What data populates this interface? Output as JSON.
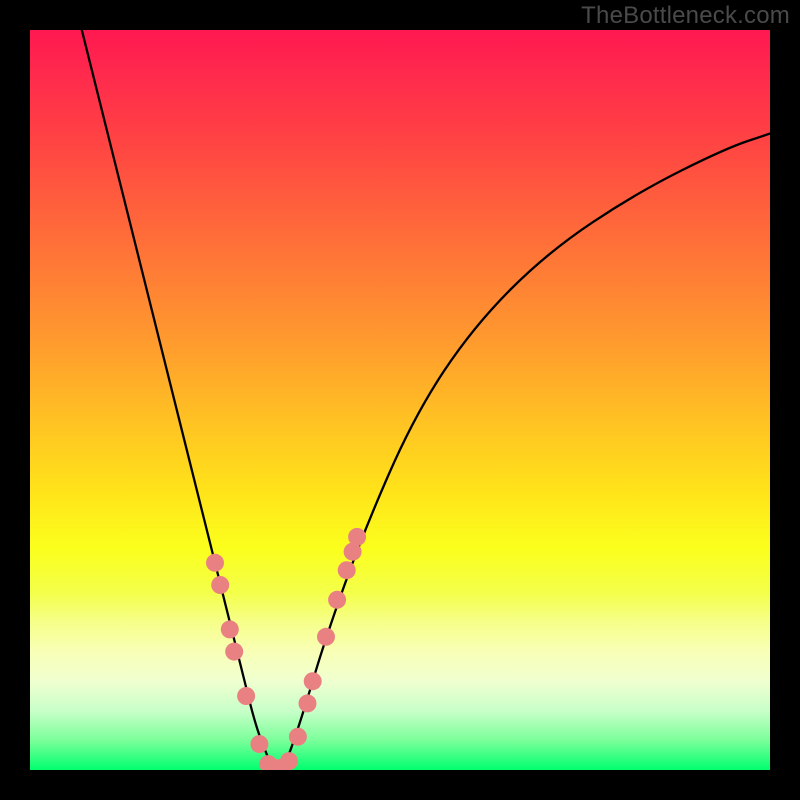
{
  "watermark": "TheBottleneck.com",
  "chart_data": {
    "type": "line",
    "title": "",
    "xlabel": "",
    "ylabel": "",
    "xlim": [
      0,
      100
    ],
    "ylim": [
      0,
      100
    ],
    "grid": false,
    "legend_position": "none",
    "series": [
      {
        "name": "bottleneck-curve",
        "x": [
          7,
          10,
          14,
          18,
          22,
          25,
          27,
          29,
          30.5,
          32,
          33,
          34,
          35,
          37,
          40,
          45,
          52,
          60,
          70,
          82,
          94,
          100
        ],
        "y": [
          100,
          88,
          72,
          56,
          40,
          28,
          20,
          12,
          6,
          2,
          0,
          0,
          2,
          8,
          18,
          32,
          48,
          60,
          70,
          78,
          84,
          86
        ]
      }
    ],
    "markers": {
      "name": "highlight-dots",
      "color": "#e98183",
      "points": [
        {
          "x": 25.0,
          "y": 28
        },
        {
          "x": 25.7,
          "y": 25
        },
        {
          "x": 27.0,
          "y": 19
        },
        {
          "x": 27.6,
          "y": 16
        },
        {
          "x": 29.2,
          "y": 10
        },
        {
          "x": 31.0,
          "y": 3.5
        },
        {
          "x": 32.2,
          "y": 0.8
        },
        {
          "x": 33.0,
          "y": 0.3
        },
        {
          "x": 34.0,
          "y": 0.3
        },
        {
          "x": 35.0,
          "y": 1.2
        },
        {
          "x": 36.2,
          "y": 4.5
        },
        {
          "x": 37.5,
          "y": 9
        },
        {
          "x": 38.2,
          "y": 12
        },
        {
          "x": 40.0,
          "y": 18
        },
        {
          "x": 41.5,
          "y": 23
        },
        {
          "x": 42.8,
          "y": 27
        },
        {
          "x": 43.6,
          "y": 29.5
        },
        {
          "x": 44.2,
          "y": 31.5
        }
      ]
    },
    "gradient_stops": [
      {
        "pos": 0,
        "color": "#ff1850"
      },
      {
        "pos": 22,
        "color": "#ff5a3e"
      },
      {
        "pos": 52,
        "color": "#ffbf24"
      },
      {
        "pos": 70,
        "color": "#fbff1c"
      },
      {
        "pos": 84,
        "color": "#f8ffb6"
      },
      {
        "pos": 100,
        "color": "#00ff6e"
      }
    ]
  }
}
